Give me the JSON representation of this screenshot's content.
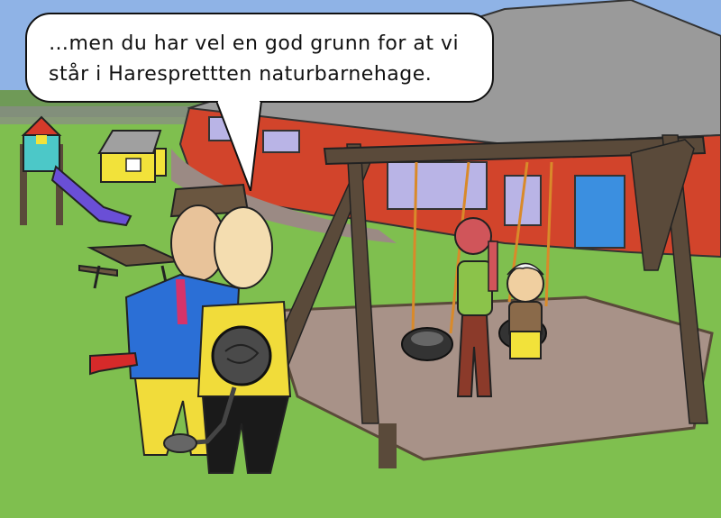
{
  "speech_bubble": {
    "text": "…men du har vel en god grunn for at vi\nstår i Haresprettten naturbarnehage."
  },
  "colors": {
    "sky": "#8fb3e6",
    "grass": "#7fbf4f",
    "building_red": "#d2442b",
    "roof_gray": "#9a9a9a",
    "wood": "#5a4a3a",
    "ground_tiles": "#a89288",
    "suit_blue": "#2b6fd6",
    "shirt_yellow": "#f1dc3a",
    "door_blue": "#3b8fe0"
  },
  "scene": {
    "characters": [
      "man-in-blue-suit",
      "bald-man-yellow-shirt",
      "red-haired-girl",
      "white-haired-child"
    ],
    "objects": [
      "wooden-swing-set",
      "tire-swing",
      "playhouse",
      "slide",
      "picnic-table",
      "ball-and-chain",
      "toy-gun"
    ]
  }
}
